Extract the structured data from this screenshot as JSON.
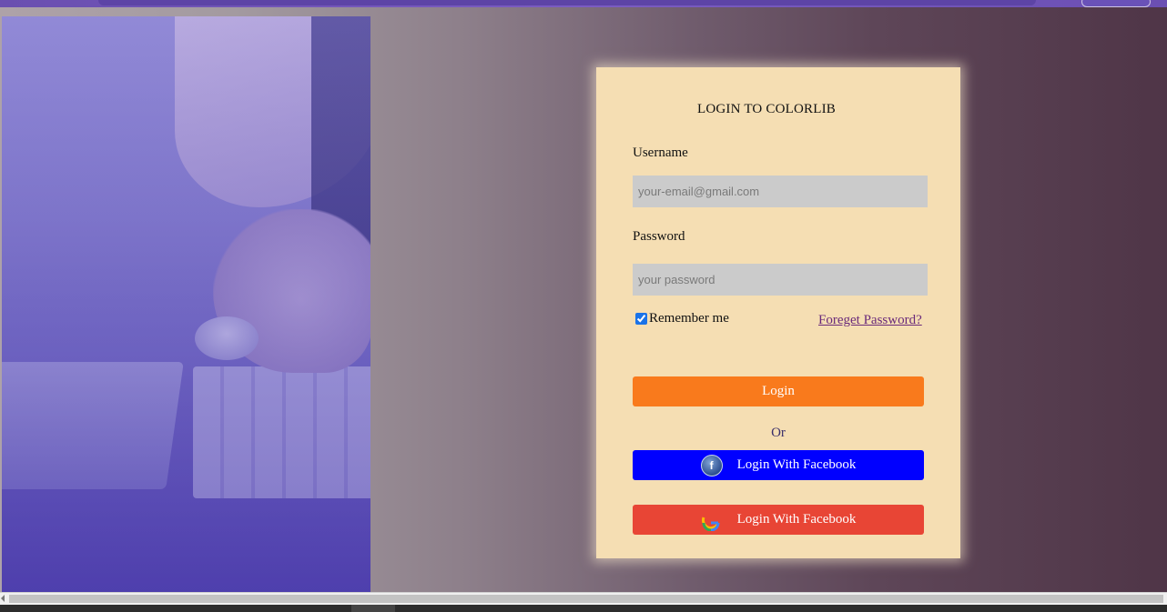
{
  "login": {
    "title": "LOGIN TO COLORLIB",
    "username_label": "Username",
    "username_placeholder": "your-email@gmail.com",
    "password_label": "Password",
    "password_placeholder": "your password",
    "remember_label": "Remember me",
    "remember_checked": true,
    "forgot_label": "Foreget Password?",
    "login_button": "Login",
    "or_text": "Or",
    "facebook_button": "Login With Facebook",
    "google_button": "Login With Facebook"
  },
  "colors": {
    "card_bg": "#f5deb3",
    "login_button": "#f97a1c",
    "facebook_button": "#0000ff",
    "google_button": "#e84535",
    "input_bg": "#cbcbcb",
    "forgot_link": "#6a2a7a"
  },
  "icons": {
    "facebook": "facebook-icon",
    "google": "google-icon"
  }
}
